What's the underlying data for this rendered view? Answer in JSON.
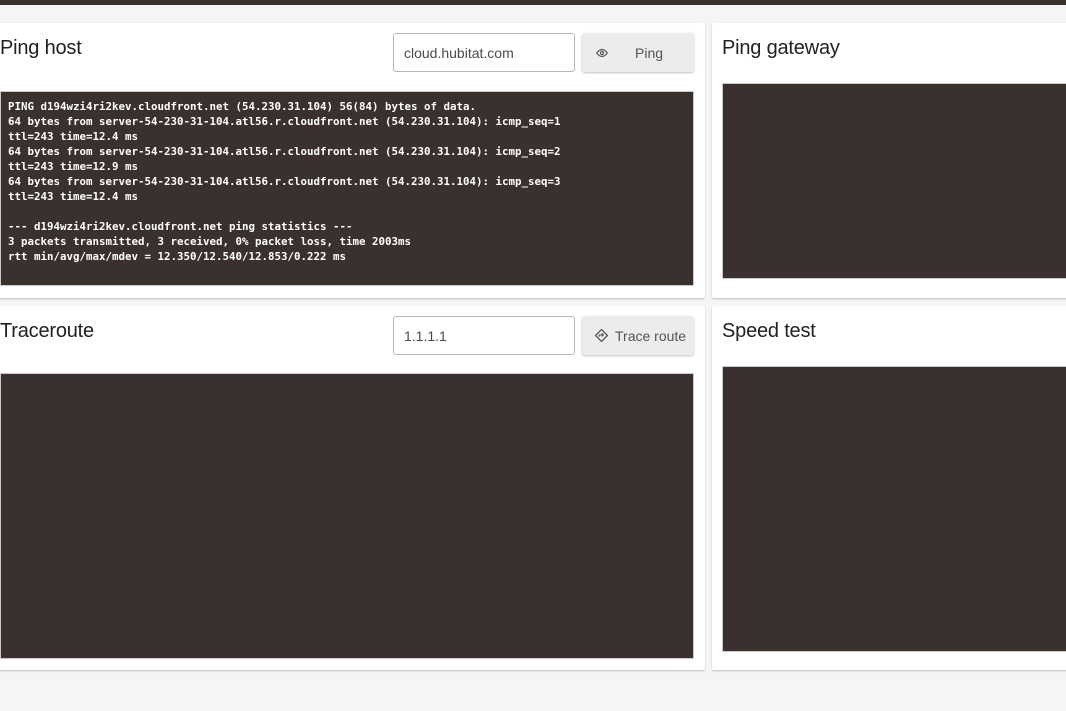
{
  "ping_host": {
    "title": "Ping host",
    "host_input": "cloud.hubitat.com",
    "button_label": "Ping",
    "output": "PING d194wzi4ri2kev.cloudfront.net (54.230.31.104) 56(84) bytes of data.\n64 bytes from server-54-230-31-104.atl56.r.cloudfront.net (54.230.31.104): icmp_seq=1\nttl=243 time=12.4 ms\n64 bytes from server-54-230-31-104.atl56.r.cloudfront.net (54.230.31.104): icmp_seq=2\nttl=243 time=12.9 ms\n64 bytes from server-54-230-31-104.atl56.r.cloudfront.net (54.230.31.104): icmp_seq=3\nttl=243 time=12.4 ms\n\n--- d194wzi4ri2kev.cloudfront.net ping statistics ---\n3 packets transmitted, 3 received, 0% packet loss, time 2003ms\nrtt min/avg/max/mdev = 12.350/12.540/12.853/0.222 ms"
  },
  "ping_gateway": {
    "title": "Ping gateway",
    "output": ""
  },
  "traceroute": {
    "title": "Traceroute",
    "host_input": "1.1.1.1",
    "button_label": "Trace route",
    "output": ""
  },
  "speed_test": {
    "title": "Speed test",
    "output": ""
  },
  "icons": {
    "ping_button": "eye-icon",
    "trace_button": "directions-icon"
  },
  "colors": {
    "console_bg": "#3a302e",
    "top_bar": "#3a302c"
  }
}
